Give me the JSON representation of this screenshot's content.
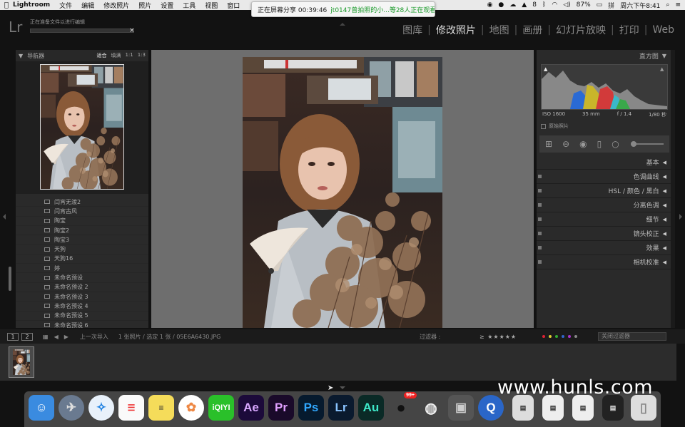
{
  "menubar": {
    "app_name": "Lightroom",
    "items": [
      "文件",
      "编辑",
      "修改照片",
      "照片",
      "设置",
      "工具",
      "视图",
      "窗口"
    ],
    "battery": "87%",
    "clock": "周六下午8:41",
    "extra": "8"
  },
  "share_banner": {
    "recording": "正在屏幕分享 00:39:46",
    "viewers": "jt0147曾拍照的小...等28人正在观看"
  },
  "topbar": {
    "logo": "Lr",
    "status": "正在准备文件以进行编辑",
    "close": "×",
    "modules": [
      "图库",
      "修改照片",
      "地图",
      "画册",
      "幻灯片放映",
      "打印",
      "Web"
    ],
    "active_module": "修改照片"
  },
  "navigator": {
    "title": "导航器",
    "zooms": [
      "适合",
      "填满",
      "1:1",
      "1:3"
    ]
  },
  "presets": [
    "闫宵无渡2",
    "闫宵古风",
    "陶宝",
    "陶宝2",
    "陶宝3",
    "天狗",
    "天狗16",
    "婷",
    "未命名预设",
    "未命名预设 2",
    "未命名预设 3",
    "未命名预设 4",
    "未命名预设 5",
    "未命名预设 6"
  ],
  "right_panel": {
    "histogram_title": "直方图",
    "exif": {
      "iso": "ISO 1600",
      "focal": "35 mm",
      "aperture": "f / 1.4",
      "shutter": "1/80 秒"
    },
    "original": "原始照片",
    "sections": [
      "基本",
      "色调曲线",
      "HSL / 颜色 / 黑白",
      "分离色调",
      "细节",
      "镜头校正",
      "效果",
      "相机校准"
    ]
  },
  "filmbar": {
    "pages": [
      "1",
      "2"
    ],
    "source": "上一次导入",
    "info": "1 张照片 / 选定 1 张 / 05E6A6430.JPG",
    "filter_label": "过滤器 :",
    "stars": "≥ ★★★★★",
    "filter_off": "关闭过滤器",
    "label_colors": [
      "#d23",
      "#dc3",
      "#3a3",
      "#36c",
      "#a3c",
      "#888"
    ]
  },
  "dock": {
    "apps": [
      "Finder",
      "Launchpad",
      "Safari",
      "Reminders",
      "Notes",
      "Photos",
      "iQIYI",
      "Ae",
      "Pr",
      "Ps",
      "Lr",
      "Au",
      "QQ",
      "WeChat",
      "Photo Booth",
      "QuickTime",
      "Trash"
    ],
    "qq_badge": "99+"
  },
  "watermark": "www.hunls.com"
}
